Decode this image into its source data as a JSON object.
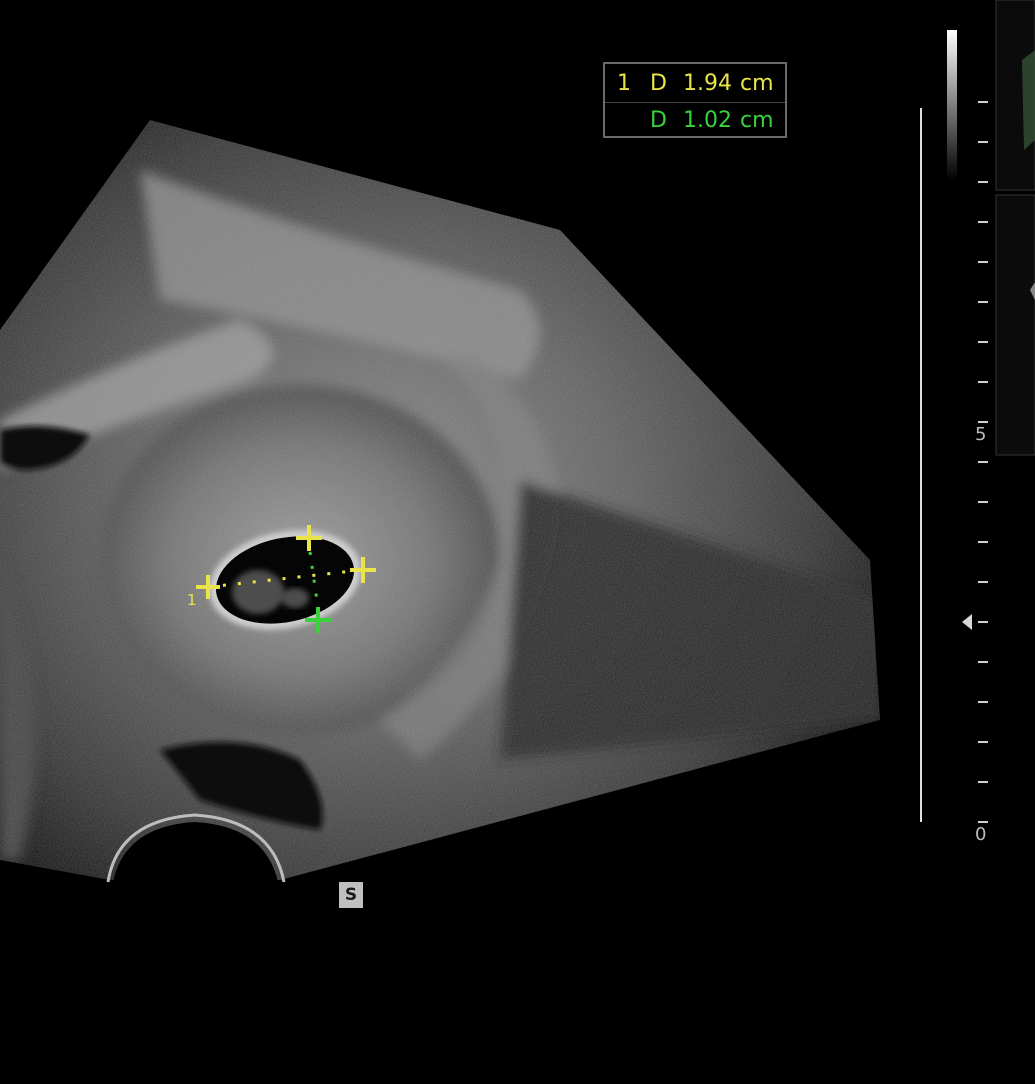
{
  "measurements": [
    {
      "index": "1",
      "label": "D",
      "value": "1.94",
      "unit": "cm",
      "color": "#e8e44a"
    },
    {
      "index": "",
      "label": "D",
      "value": "1.02",
      "unit": "cm",
      "color": "#39d23c"
    }
  ],
  "caliper_label": "1",
  "depth_scale": {
    "top_label": "5",
    "bottom_label": "0"
  },
  "orientation_marker": "S",
  "colors": {
    "background": "#000000",
    "caliper_yellow": "#e8e44a",
    "caliper_green": "#39d23c",
    "scale_white": "#e0e0e0"
  }
}
